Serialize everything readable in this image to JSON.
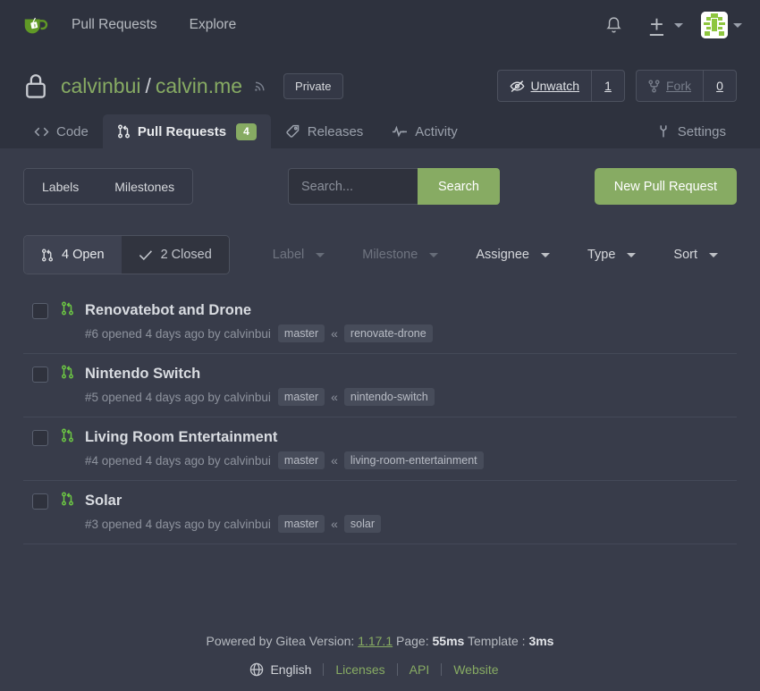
{
  "navbar": {
    "logo_name": "gitea-logo",
    "links": [
      {
        "label": "Pull Requests"
      },
      {
        "label": "Explore"
      }
    ],
    "notification_icon": "bell-icon",
    "create_icon": "plus-icon",
    "avatar_name": "user-avatar"
  },
  "repo": {
    "visibility_icon": "lock-icon",
    "owner": "calvinbui",
    "separator": "/",
    "name": "calvin.me",
    "rss_icon": "rss-icon",
    "private_label": "Private",
    "watch_label": "Unwatch",
    "watch_count": "1",
    "fork_label": "Fork",
    "fork_count": "0"
  },
  "tabs": [
    {
      "label": "Code",
      "icon": "code-icon",
      "active": false
    },
    {
      "label": "Pull Requests",
      "icon": "git-pull-request-icon",
      "badge": "4",
      "active": true
    },
    {
      "label": "Releases",
      "icon": "tag-icon",
      "active": false
    },
    {
      "label": "Activity",
      "icon": "pulse-icon",
      "active": false
    },
    {
      "label": "Settings",
      "icon": "tools-icon",
      "active": false
    }
  ],
  "toolbar": {
    "labels_label": "Labels",
    "milestones_label": "Milestones",
    "search_placeholder": "Search...",
    "search_value": "",
    "search_button": "Search",
    "new_pr_button": "New Pull Request"
  },
  "filters": {
    "open_label": "4 Open",
    "closed_label": "2 Closed",
    "dropdowns": [
      {
        "label": "Label",
        "dim": true
      },
      {
        "label": "Milestone",
        "dim": true
      },
      {
        "label": "Assignee",
        "dim": false
      },
      {
        "label": "Type",
        "dim": false
      },
      {
        "label": "Sort",
        "dim": false
      }
    ]
  },
  "pull_requests": [
    {
      "title": "Renovatebot and Drone",
      "meta": "#6 opened 4 days ago by calvinbui",
      "base_branch": "master",
      "arrow": "«",
      "head_branch": "renovate-drone"
    },
    {
      "title": "Nintendo Switch",
      "meta": "#5 opened 4 days ago by calvinbui",
      "base_branch": "master",
      "arrow": "«",
      "head_branch": "nintendo-switch"
    },
    {
      "title": "Living Room Entertainment",
      "meta": "#4 opened 4 days ago by calvinbui",
      "base_branch": "master",
      "arrow": "«",
      "head_branch": "living-room-entertainment"
    },
    {
      "title": "Solar",
      "meta": "#3 opened 4 days ago by calvinbui",
      "base_branch": "master",
      "arrow": "«",
      "head_branch": "solar"
    }
  ],
  "footer": {
    "powered_by": "Powered by Gitea Version:",
    "version": "1.17.1",
    "page_label": "Page:",
    "page_time": "55ms",
    "template_label": "Template :",
    "template_time": "3ms",
    "globe_icon": "globe-icon",
    "language": "English",
    "links": [
      {
        "label": "Licenses"
      },
      {
        "label": "API"
      },
      {
        "label": "Website"
      }
    ]
  },
  "colors": {
    "accent_green": "#87ab63",
    "pr_icon_green": "#6cc644",
    "body_bg": "#383c4a",
    "header_bg": "#2e323e"
  }
}
